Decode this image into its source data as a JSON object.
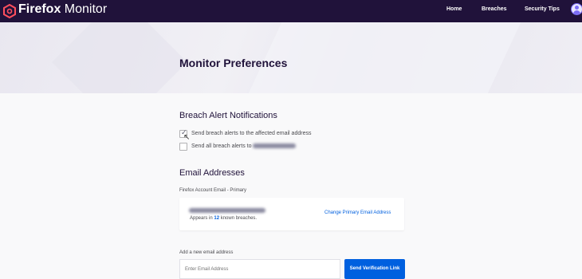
{
  "header": {
    "brand_bold": "Firefox",
    "brand_light": "Monitor",
    "nav": [
      "Home",
      "Breaches",
      "Security Tips"
    ]
  },
  "page": {
    "title": "Monitor Preferences"
  },
  "alerts": {
    "heading": "Breach Alert Notifications",
    "option1": "Send breach alerts to the affected email address",
    "option1_checked": true,
    "option2": "Send all breach alerts to",
    "option2_checked": false
  },
  "emails": {
    "heading": "Email Addresses",
    "primary_label": "Firefox Account Email - Primary",
    "appears_prefix": "Appears in",
    "breach_count": "12",
    "appears_suffix": "known breaches.",
    "change_link": "Change Primary Email Address",
    "add_label": "Add a new email address",
    "input_placeholder": "Enter Email Address",
    "send_button": "Send Verification Link"
  },
  "colors": {
    "header": "#20123a",
    "accent": "#0060df"
  }
}
